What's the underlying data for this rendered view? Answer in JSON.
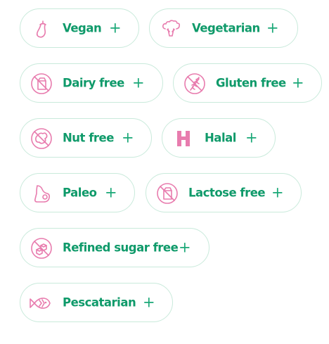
{
  "chips": [
    {
      "label": "Vegan",
      "icon": "eggplant-icon",
      "plus": "+"
    },
    {
      "label": "Vegetarian",
      "icon": "broccoli-icon",
      "plus": "+"
    },
    {
      "label": "Dairy free",
      "icon": "no-milk-carton-icon",
      "plus": "+"
    },
    {
      "label": "Gluten free",
      "icon": "no-wheat-icon",
      "plus": "+"
    },
    {
      "label": "Nut free",
      "icon": "no-nut-icon",
      "plus": "+"
    },
    {
      "label": "Halal",
      "icon": "halal-h-icon",
      "plus": "+"
    },
    {
      "label": "Paleo",
      "icon": "meat-steak-icon",
      "plus": "+"
    },
    {
      "label": "Lactose free",
      "icon": "no-milk-carton-icon",
      "plus": "+"
    },
    {
      "label": "Refined sugar free",
      "icon": "no-sugar-cube-icon",
      "plus": "+"
    },
    {
      "label": "Pescatarian",
      "icon": "fish-icon",
      "plus": "+"
    }
  ],
  "colors": {
    "accent": "#0f9a6a",
    "icon": "#e87cae",
    "border": "#c9eadb"
  }
}
